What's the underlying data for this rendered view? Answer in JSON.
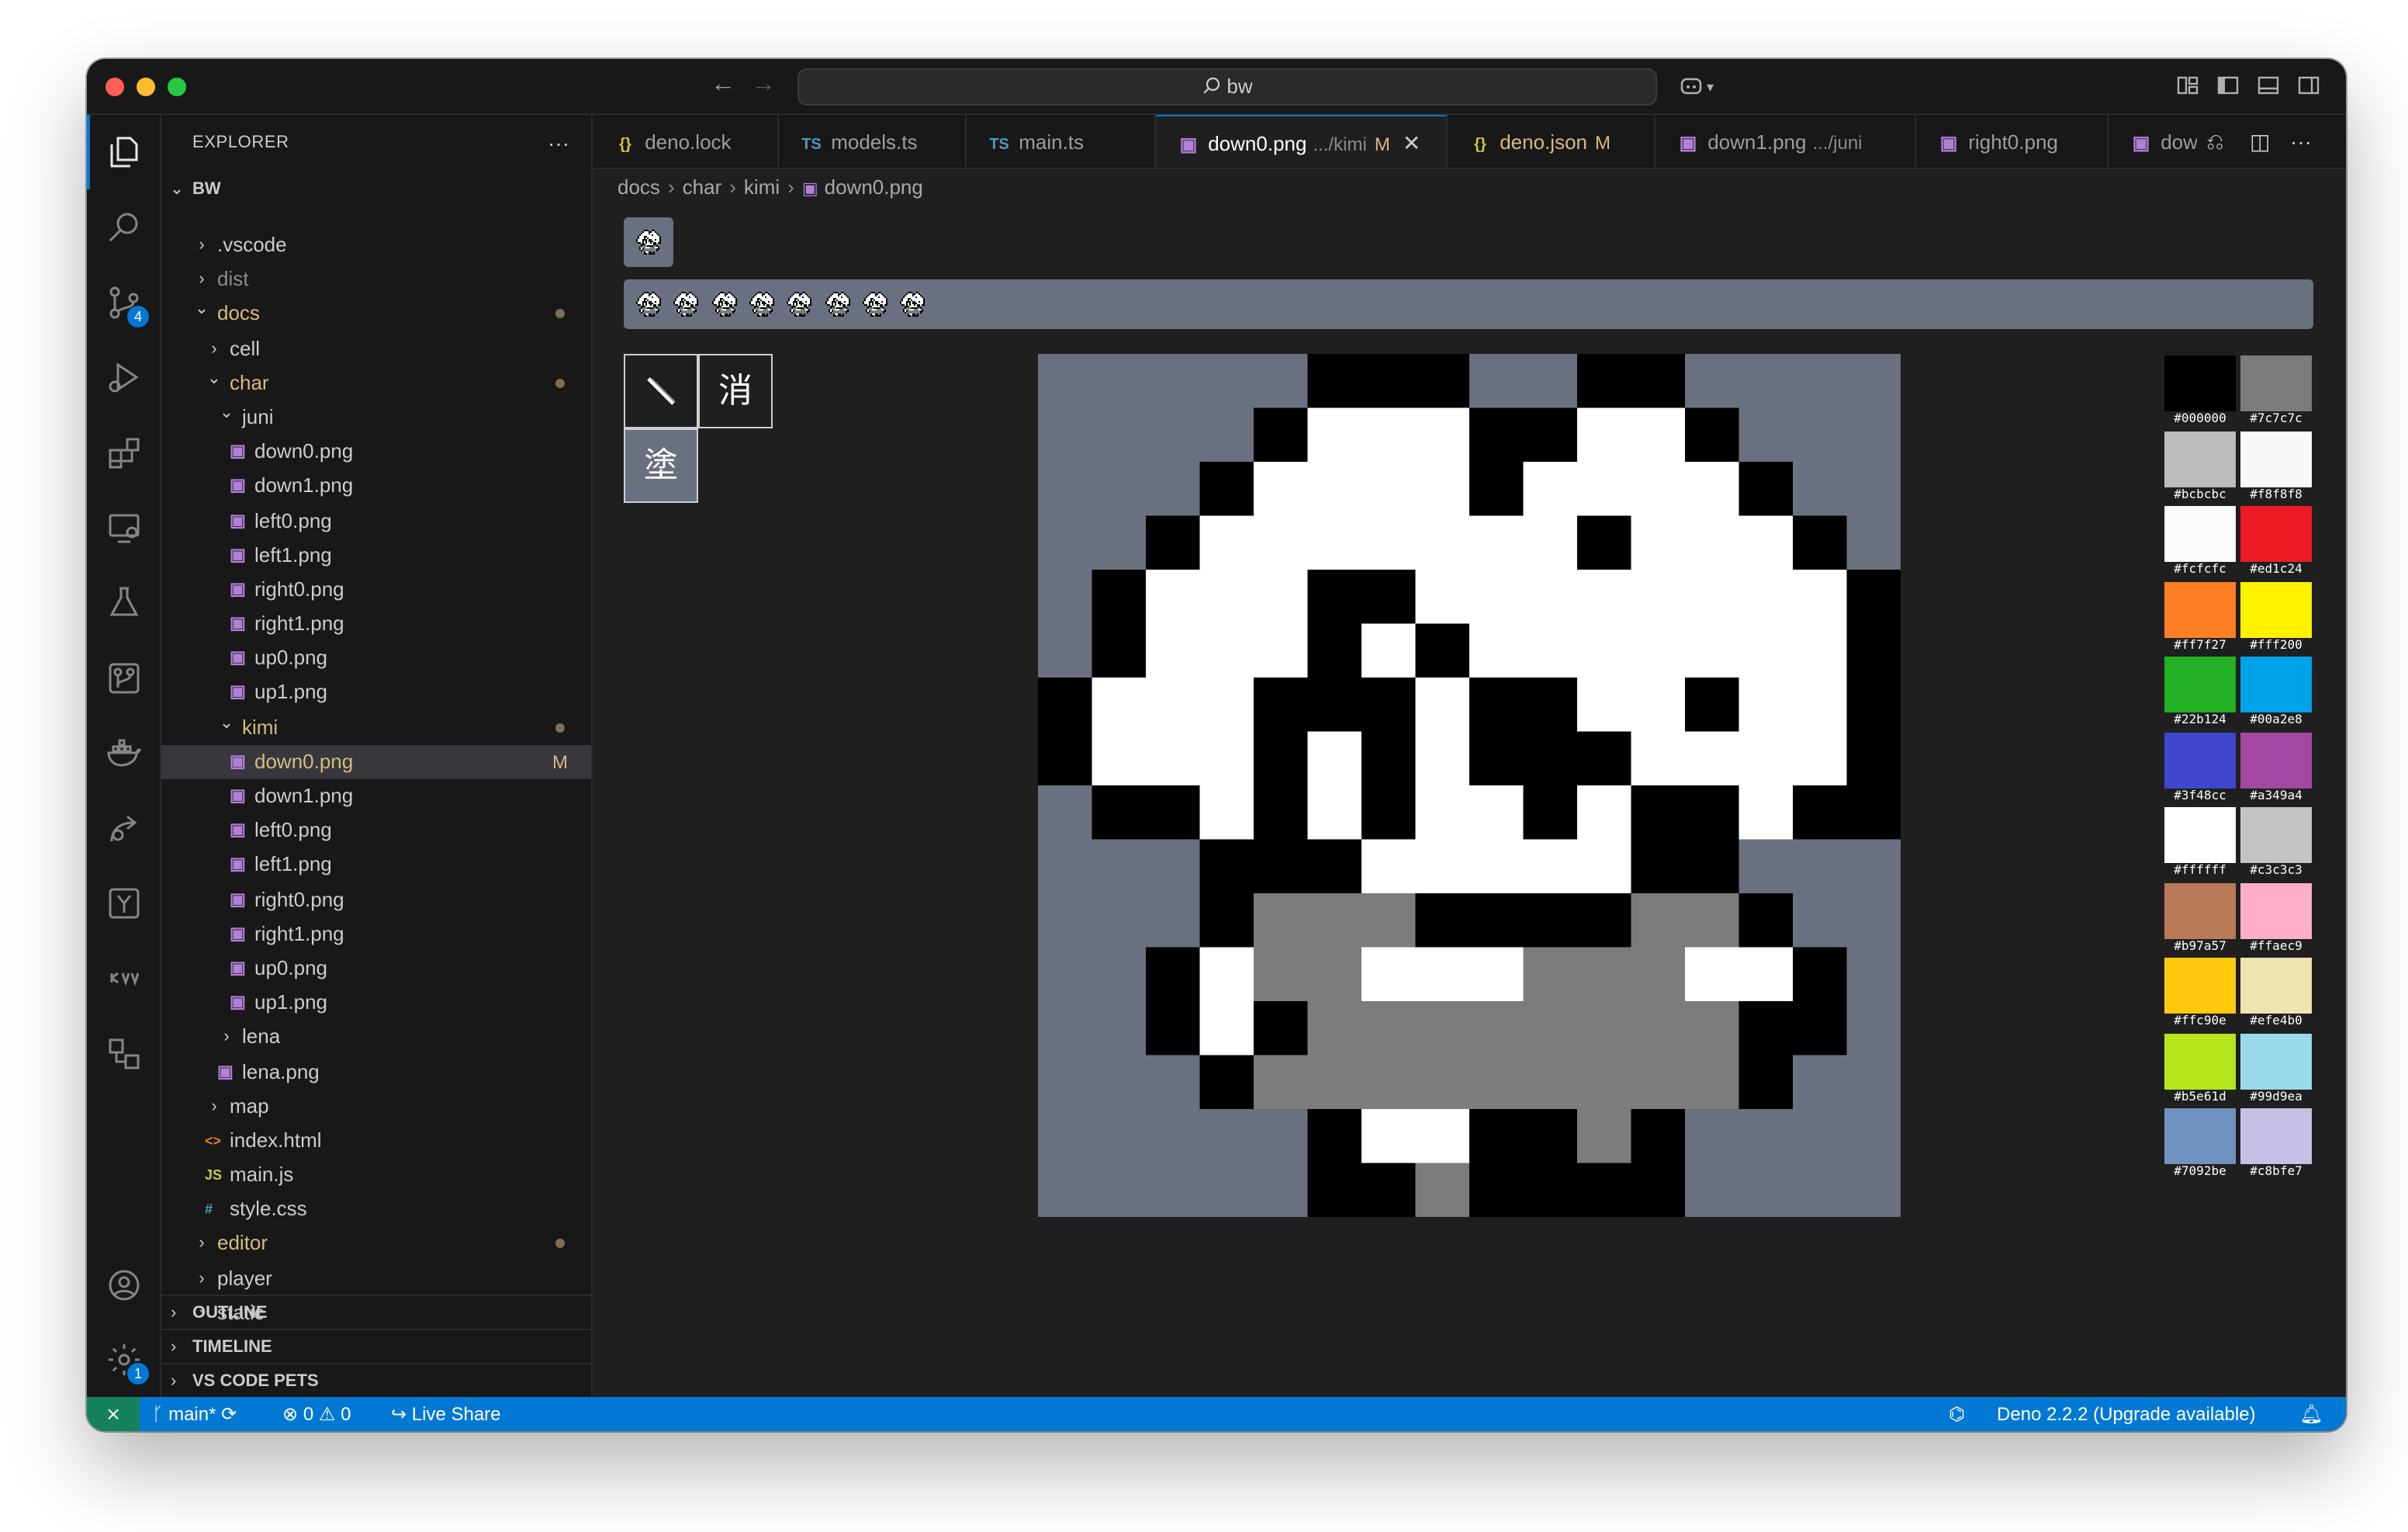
{
  "window": {
    "search_text": "bw",
    "colors": {
      "accent": "#0078d4",
      "status_bar": "#0078d4",
      "modified": "#d7ba7d"
    }
  },
  "activity_bar": {
    "items": [
      "explorer-icon",
      "search-icon",
      "source-control-icon",
      "run-debug-icon",
      "extensions-icon",
      "remote-explorer-icon",
      "testing-icon",
      "git-graph-icon",
      "docker-icon",
      "live-share-icon",
      "deno-icon",
      "kv-icon",
      "project-manager-icon"
    ],
    "source_control_badge": "4",
    "settings_badge": "1"
  },
  "sidebar": {
    "title": "EXPLORER",
    "more": "···",
    "root": "BW",
    "tree": [
      {
        "label": ".vscode",
        "type": "folder",
        "depth": 1,
        "open": false
      },
      {
        "label": "dist",
        "type": "folder",
        "depth": 1,
        "open": false,
        "dim": true
      },
      {
        "label": "docs",
        "type": "folder",
        "depth": 1,
        "open": true,
        "modified": true,
        "dot": true
      },
      {
        "label": "cell",
        "type": "folder",
        "depth": 2,
        "open": false
      },
      {
        "label": "char",
        "type": "folder",
        "depth": 2,
        "open": true,
        "modified": true,
        "dot": true
      },
      {
        "label": "juni",
        "type": "folder",
        "depth": 3,
        "open": true
      },
      {
        "label": "down0.png",
        "type": "image",
        "depth": 4
      },
      {
        "label": "down1.png",
        "type": "image",
        "depth": 4
      },
      {
        "label": "left0.png",
        "type": "image",
        "depth": 4
      },
      {
        "label": "left1.png",
        "type": "image",
        "depth": 4
      },
      {
        "label": "right0.png",
        "type": "image",
        "depth": 4
      },
      {
        "label": "right1.png",
        "type": "image",
        "depth": 4
      },
      {
        "label": "up0.png",
        "type": "image",
        "depth": 4
      },
      {
        "label": "up1.png",
        "type": "image",
        "depth": 4
      },
      {
        "label": "kimi",
        "type": "folder",
        "depth": 3,
        "open": true,
        "modified": true,
        "dot": true
      },
      {
        "label": "down0.png",
        "type": "image",
        "depth": 4,
        "modified": true,
        "flag": "M",
        "selected": true
      },
      {
        "label": "down1.png",
        "type": "image",
        "depth": 4
      },
      {
        "label": "left0.png",
        "type": "image",
        "depth": 4
      },
      {
        "label": "left1.png",
        "type": "image",
        "depth": 4
      },
      {
        "label": "right0.png",
        "type": "image",
        "depth": 4
      },
      {
        "label": "right1.png",
        "type": "image",
        "depth": 4
      },
      {
        "label": "up0.png",
        "type": "image",
        "depth": 4
      },
      {
        "label": "up1.png",
        "type": "image",
        "depth": 4
      },
      {
        "label": "lena",
        "type": "folder",
        "depth": 3,
        "open": false
      },
      {
        "label": "lena.png",
        "type": "image",
        "depth": 3
      },
      {
        "label": "map",
        "type": "folder",
        "depth": 2,
        "open": false
      },
      {
        "label": "index.html",
        "type": "html",
        "depth": 2
      },
      {
        "label": "main.js",
        "type": "js",
        "depth": 2
      },
      {
        "label": "style.css",
        "type": "css",
        "depth": 2
      },
      {
        "label": "editor",
        "type": "folder",
        "depth": 1,
        "open": false,
        "modified": true,
        "dot": true
      },
      {
        "label": "player",
        "type": "folder",
        "depth": 1,
        "open": false
      },
      {
        "label": "static",
        "type": "folder",
        "depth": 1,
        "open": false
      }
    ],
    "sections": [
      "OUTLINE",
      "TIMELINE",
      "VS CODE PETS"
    ]
  },
  "tabs": [
    {
      "icon": "{}",
      "label": "deno.lock",
      "kind": "json"
    },
    {
      "icon": "TS",
      "label": "models.ts",
      "kind": "ts"
    },
    {
      "icon": "TS",
      "label": "main.ts",
      "kind": "ts"
    },
    {
      "icon": "img",
      "label": "down0.png",
      "desc": ".../kimi",
      "flag": "M",
      "active": true
    },
    {
      "icon": "{}",
      "label": "deno.json",
      "flag": "M",
      "modified": true,
      "kind": "json"
    },
    {
      "icon": "img",
      "label": "down1.png",
      "desc": ".../juni"
    },
    {
      "icon": "img",
      "label": "right0.png"
    },
    {
      "icon": "img",
      "label": "dow"
    }
  ],
  "breadcrumb": [
    "docs",
    "char",
    "kimi",
    "down0.png"
  ],
  "editor": {
    "tools": [
      "brush-icon",
      "消",
      "塗"
    ],
    "frame_count": 8,
    "sprite": {
      "palette": {
        "0": "#6b7080",
        "1": "#000000",
        "2": "#ffffff",
        "3": "#7c7c7c"
      },
      "rows": [
        "0000011100110000",
        "0000122211221000",
        "0001222212222100",
        "0012222222122210",
        "0122211222222221",
        "0122212122222221",
        "1222111211221221",
        "1222121211122221",
        "0112121221211211",
        "0001112222211000",
        "0001333111133100",
        "0012332223332210",
        "0012133333333110",
        "0001333333333100",
        "0000012211310000",
        "0000011311110000"
      ]
    }
  },
  "palette": [
    {
      "hex": "#000000",
      "label": "#000000"
    },
    {
      "hex": "#7c7c7c",
      "label": "#7c7c7c"
    },
    {
      "hex": "#bcbcbc",
      "label": "#bcbcbc"
    },
    {
      "hex": "#f8f8f8",
      "label": "#f8f8f8"
    },
    {
      "hex": "#fcfcfc",
      "label": "#fcfcfc"
    },
    {
      "hex": "#ed1c24",
      "label": "#ed1c24"
    },
    {
      "hex": "#ff7f27",
      "label": "#ff7f27"
    },
    {
      "hex": "#fff200",
      "label": "#fff200"
    },
    {
      "hex": "#22b124",
      "label": "#22b124"
    },
    {
      "hex": "#00a2e8",
      "label": "#00a2e8"
    },
    {
      "hex": "#3f48cc",
      "label": "#3f48cc"
    },
    {
      "hex": "#a349a4",
      "label": "#a349a4"
    },
    {
      "hex": "#ffffff",
      "label": "#ffffff"
    },
    {
      "hex": "#c3c3c3",
      "label": "#c3c3c3"
    },
    {
      "hex": "#b97a57",
      "label": "#b97a57"
    },
    {
      "hex": "#ffaec9",
      "label": "#ffaec9"
    },
    {
      "hex": "#ffc90e",
      "label": "#ffc90e"
    },
    {
      "hex": "#efe4b0",
      "label": "#efe4b0"
    },
    {
      "hex": "#b5e61d",
      "label": "#b5e61d"
    },
    {
      "hex": "#99d9ea",
      "label": "#99d9ea"
    },
    {
      "hex": "#7092be",
      "label": "#7092be"
    },
    {
      "hex": "#c8bfe7",
      "label": "#c8bfe7"
    }
  ],
  "status": {
    "branch": "main*",
    "errors": "0",
    "warnings": "0",
    "live_share": "Live Share",
    "deno": "Deno 2.2.2 (Upgrade available)"
  }
}
